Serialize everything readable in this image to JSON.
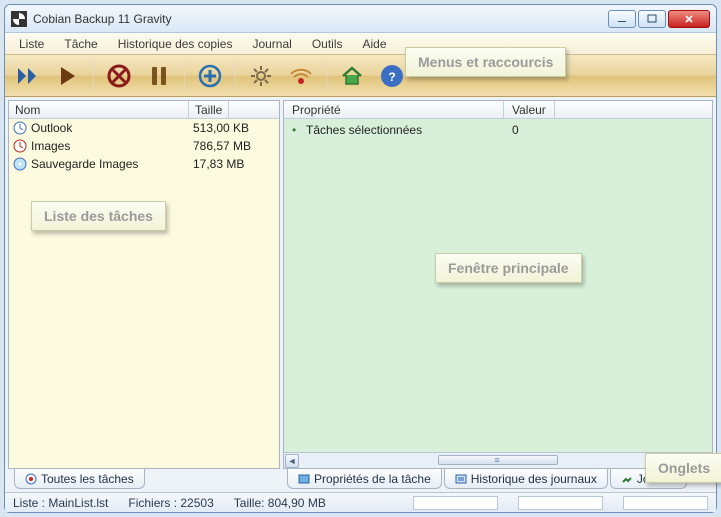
{
  "window": {
    "title": "Cobian Backup 11 Gravity"
  },
  "menu": {
    "items": [
      "Liste",
      "Tâche",
      "Historique des copies",
      "Journal",
      "Outils",
      "Aide"
    ]
  },
  "left": {
    "cols": {
      "name": "Nom",
      "size": "Taille"
    },
    "rows": [
      {
        "name": "Outlook",
        "size": "513,00 KB",
        "icon": "clock"
      },
      {
        "name": "Images",
        "size": "786,57 MB",
        "icon": "clock-red"
      },
      {
        "name": "Sauvegarde Images",
        "size": "17,83 MB",
        "icon": "disc"
      }
    ],
    "tab": {
      "label": "Toutes les tâches"
    }
  },
  "right": {
    "cols": {
      "prop": "Propriété",
      "val": "Valeur"
    },
    "rows": [
      {
        "prop": "Tâches sélectionnées",
        "val": "0"
      }
    ],
    "tabs": [
      {
        "label": "Propriétés de la tâche"
      },
      {
        "label": "Historique des journaux"
      },
      {
        "label": "Journal"
      }
    ]
  },
  "status": {
    "list": "Liste : MainList.lst",
    "files": "Fichiers : 22503",
    "size": "Taille: 804,90 MB"
  },
  "callouts": {
    "menus": "Menus et raccourcis",
    "tasks": "Liste des tâches",
    "main": "Fenêtre principale",
    "tabs": "Onglets"
  }
}
